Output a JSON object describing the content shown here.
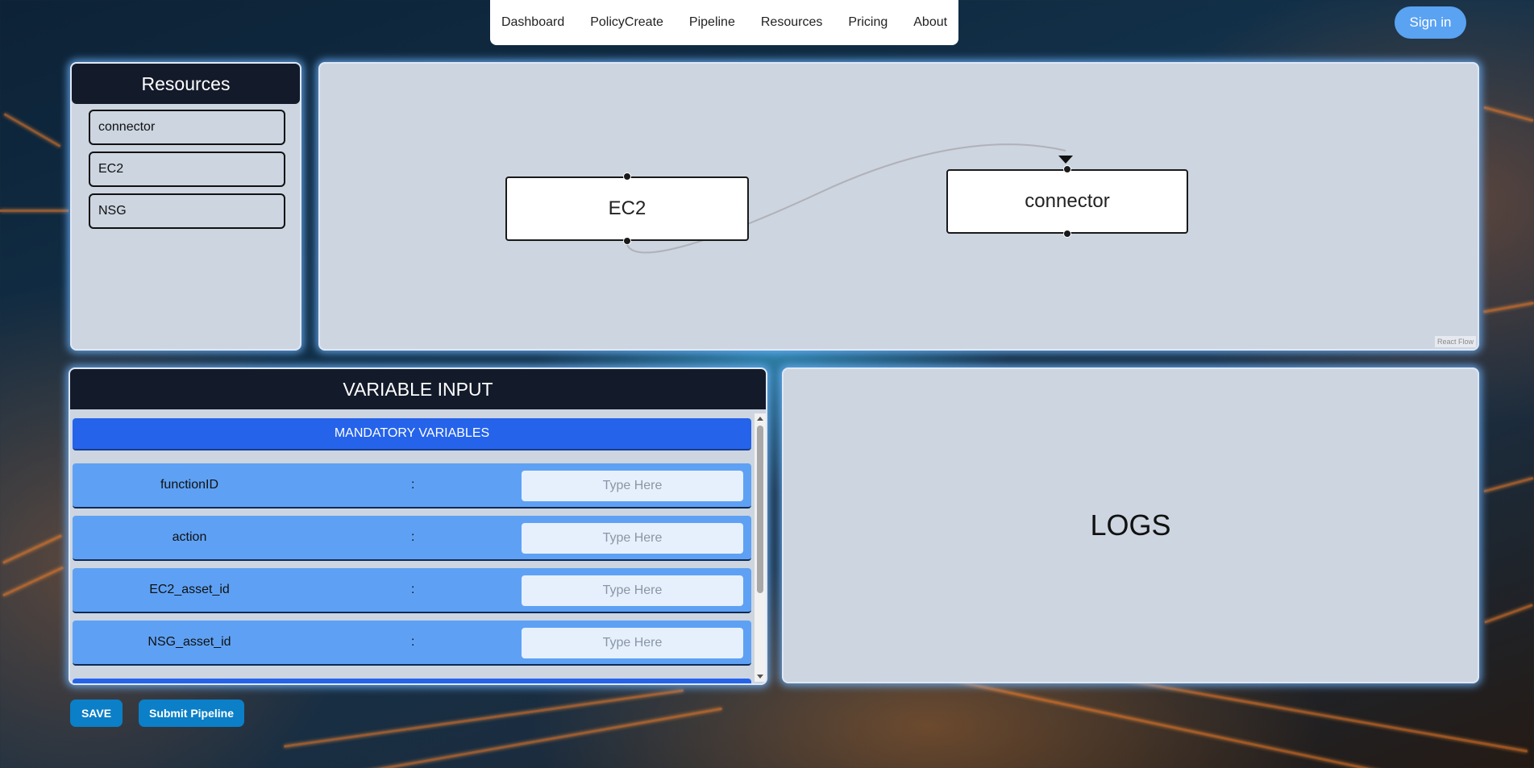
{
  "nav": {
    "links": [
      "Dashboard",
      "PolicyCreate",
      "Pipeline",
      "Resources",
      "Pricing",
      "About"
    ],
    "signin_label": "Sign in"
  },
  "resources": {
    "title": "Resources",
    "items": [
      "connector",
      "EC2",
      "NSG"
    ]
  },
  "flow": {
    "nodes": [
      {
        "label": "EC2"
      },
      {
        "label": "connector"
      }
    ],
    "attribution": "React Flow"
  },
  "variable_input": {
    "title": "VARIABLE INPUT",
    "section_label": "MANDATORY VARIABLES",
    "separator": ":",
    "placeholder": "Type Here",
    "variables": [
      "functionID",
      "action",
      "EC2_asset_id",
      "NSG_asset_id"
    ]
  },
  "logs": {
    "title": "LOGS"
  },
  "actions": {
    "save_label": "SAVE",
    "submit_label": "Submit Pipeline"
  },
  "colors": {
    "accent_blue": "#2563eb",
    "row_blue": "#5ea1f4",
    "header_dark": "#131a2a",
    "panel_bg": "#ccd5e0",
    "button_blue": "#0b7fc7",
    "signin_blue": "#5aa2f2"
  }
}
